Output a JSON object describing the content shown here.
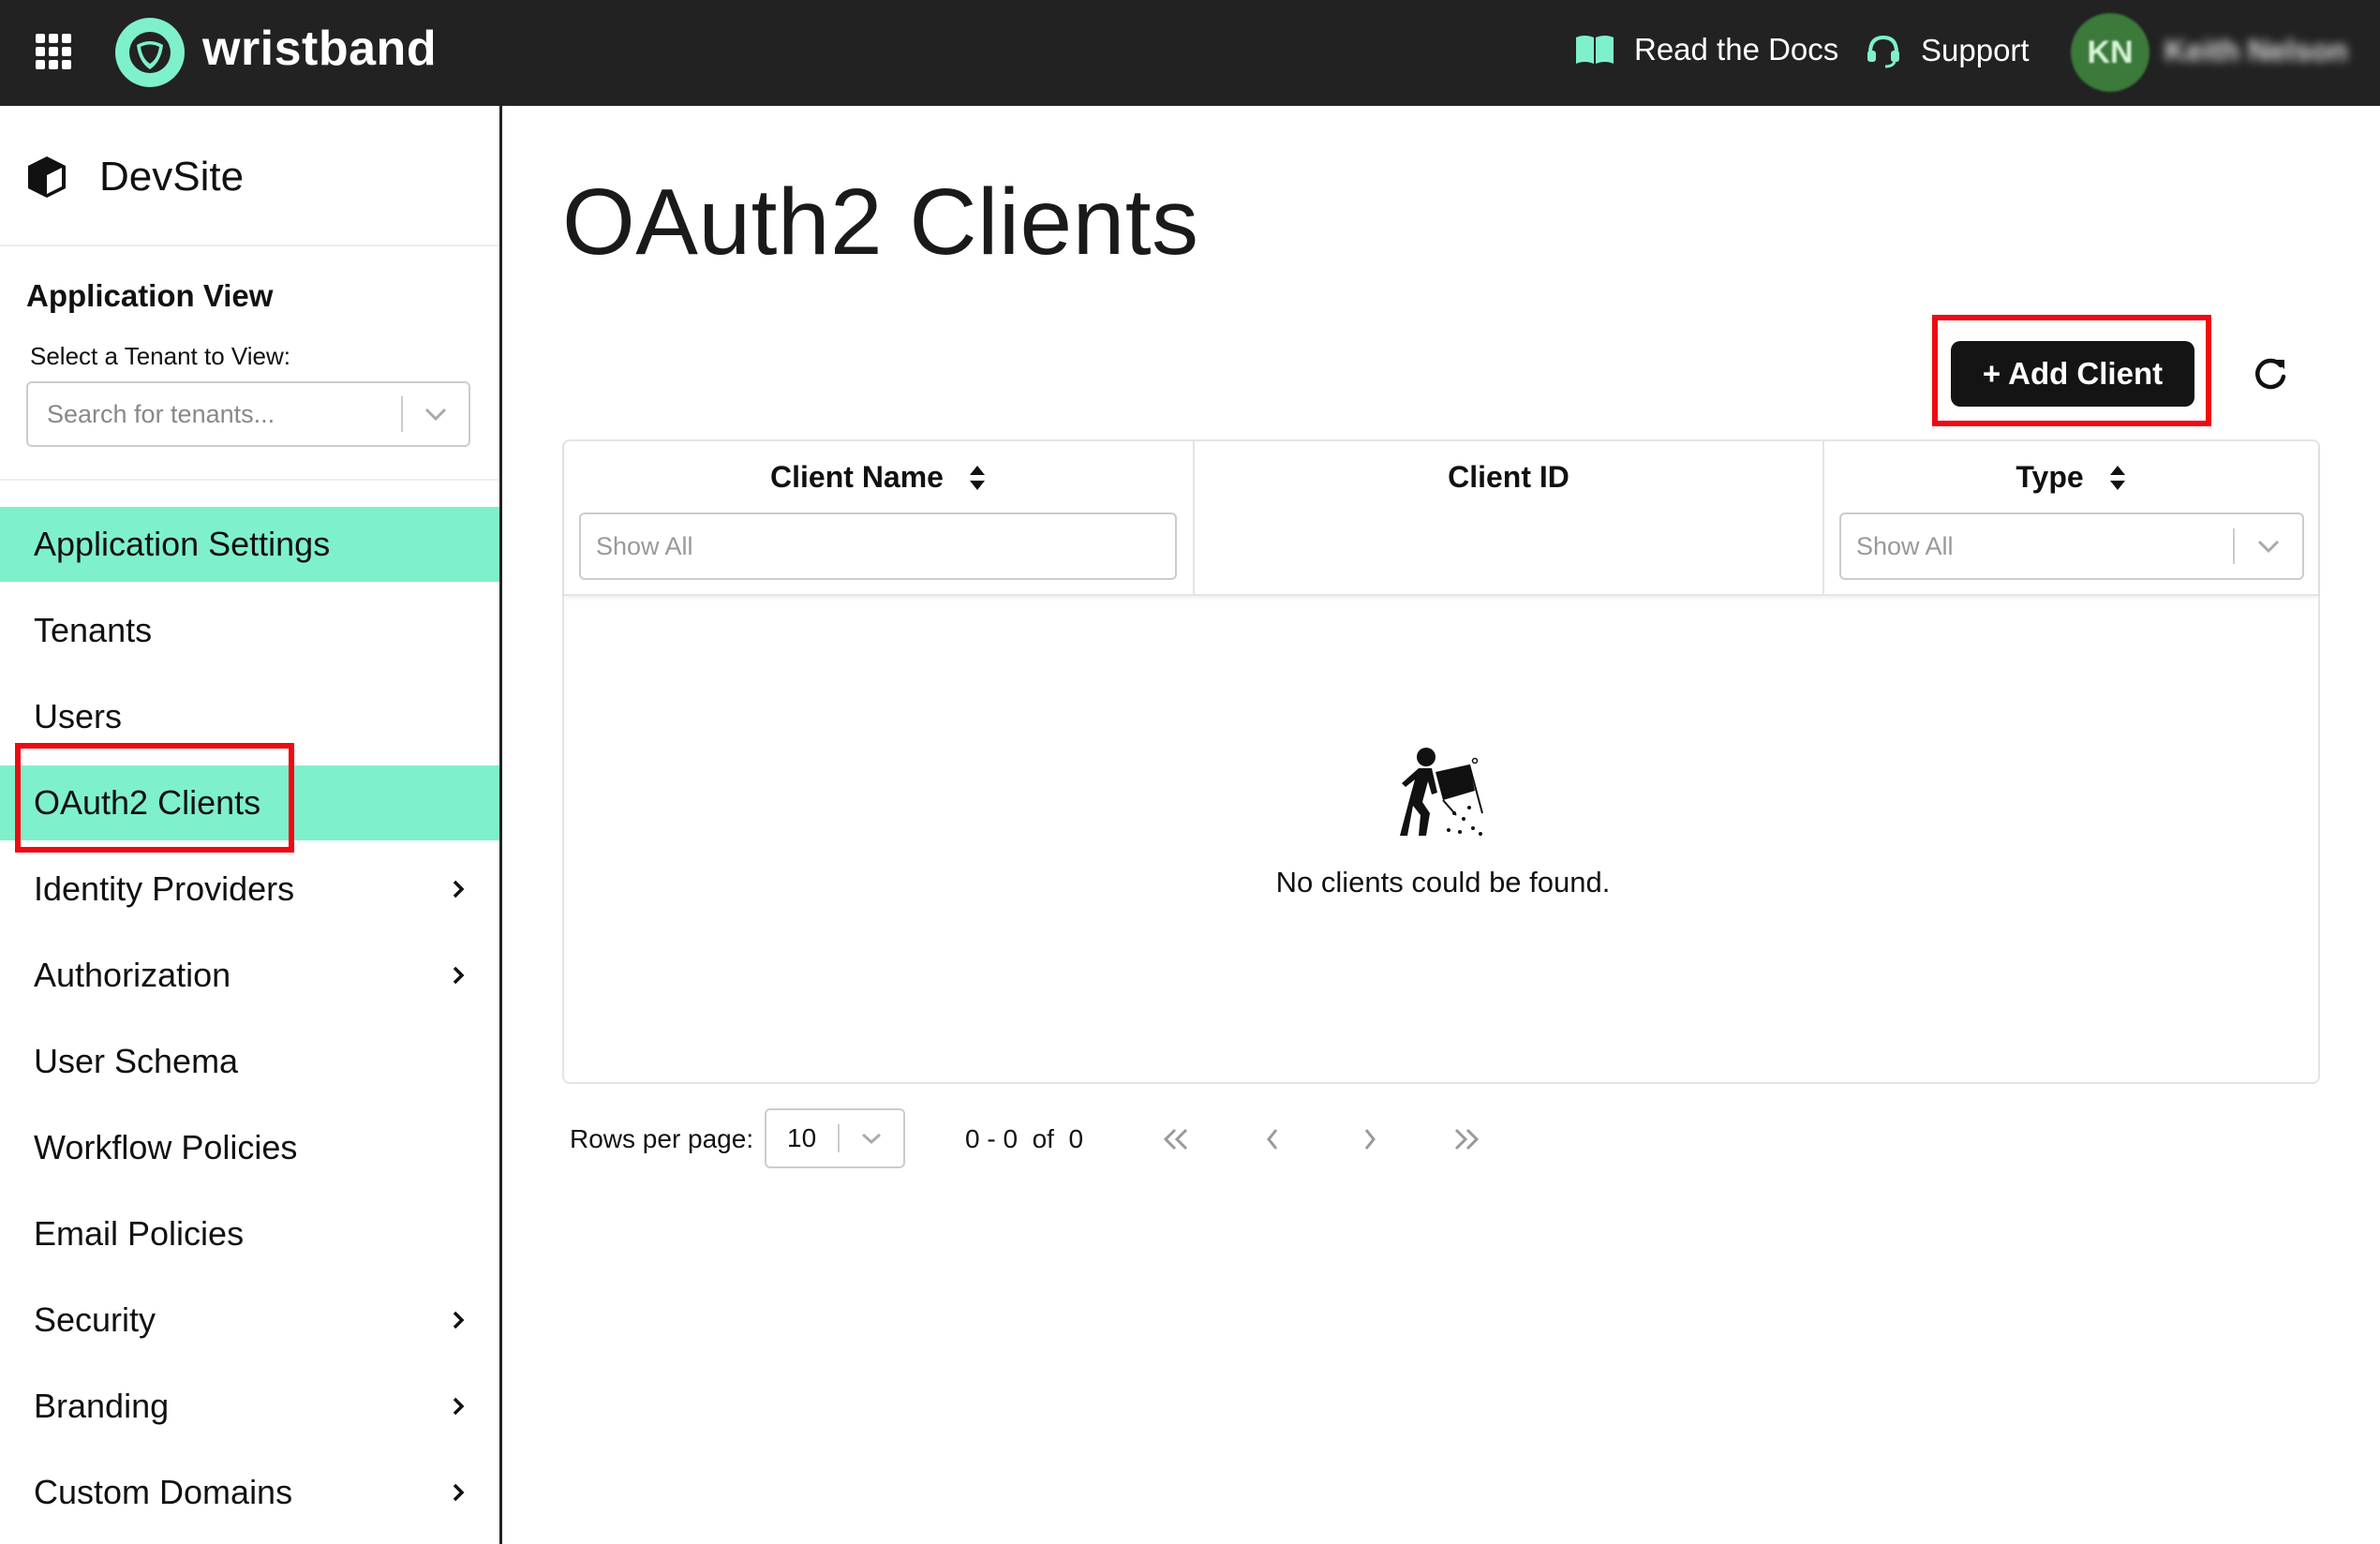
{
  "topbar": {
    "brand": "wristband",
    "docs_label": "Read the Docs",
    "support_label": "Support",
    "avatar_initials": "KN",
    "user_name": "Keith Nelson",
    "accent_color": "#7ff0cc"
  },
  "sidebar": {
    "site_name": "DevSite",
    "app_view_title": "Application View",
    "tenant_label": "Select a Tenant to View:",
    "tenant_placeholder": "Search for tenants...",
    "items": [
      {
        "label": "Application Settings",
        "active": true,
        "has_submenu": false
      },
      {
        "label": "Tenants",
        "active": false,
        "has_submenu": false
      },
      {
        "label": "Users",
        "active": false,
        "has_submenu": false
      },
      {
        "label": "OAuth2 Clients",
        "active": true,
        "has_submenu": false
      },
      {
        "label": "Identity Providers",
        "active": false,
        "has_submenu": true
      },
      {
        "label": "Authorization",
        "active": false,
        "has_submenu": true
      },
      {
        "label": "User Schema",
        "active": false,
        "has_submenu": false
      },
      {
        "label": "Workflow Policies",
        "active": false,
        "has_submenu": false
      },
      {
        "label": "Email Policies",
        "active": false,
        "has_submenu": false
      },
      {
        "label": "Security",
        "active": false,
        "has_submenu": true
      },
      {
        "label": "Branding",
        "active": false,
        "has_submenu": true
      },
      {
        "label": "Custom Domains",
        "active": false,
        "has_submenu": true
      }
    ]
  },
  "main": {
    "page_title": "OAuth2 Clients",
    "add_button_label": "+ Add Client",
    "table": {
      "columns": [
        {
          "label": "Client Name",
          "sortable": true,
          "filter_placeholder": "Show All"
        },
        {
          "label": "Client ID",
          "sortable": false,
          "filter_placeholder": ""
        },
        {
          "label": "Type",
          "sortable": true,
          "filter_placeholder": "Show All"
        }
      ],
      "empty_message": "No clients could be found."
    },
    "pagination": {
      "rows_label": "Rows per page:",
      "rows_value": "10",
      "range_text": "0 - 0  of  0"
    }
  },
  "highlight_color": "#ee0a12"
}
